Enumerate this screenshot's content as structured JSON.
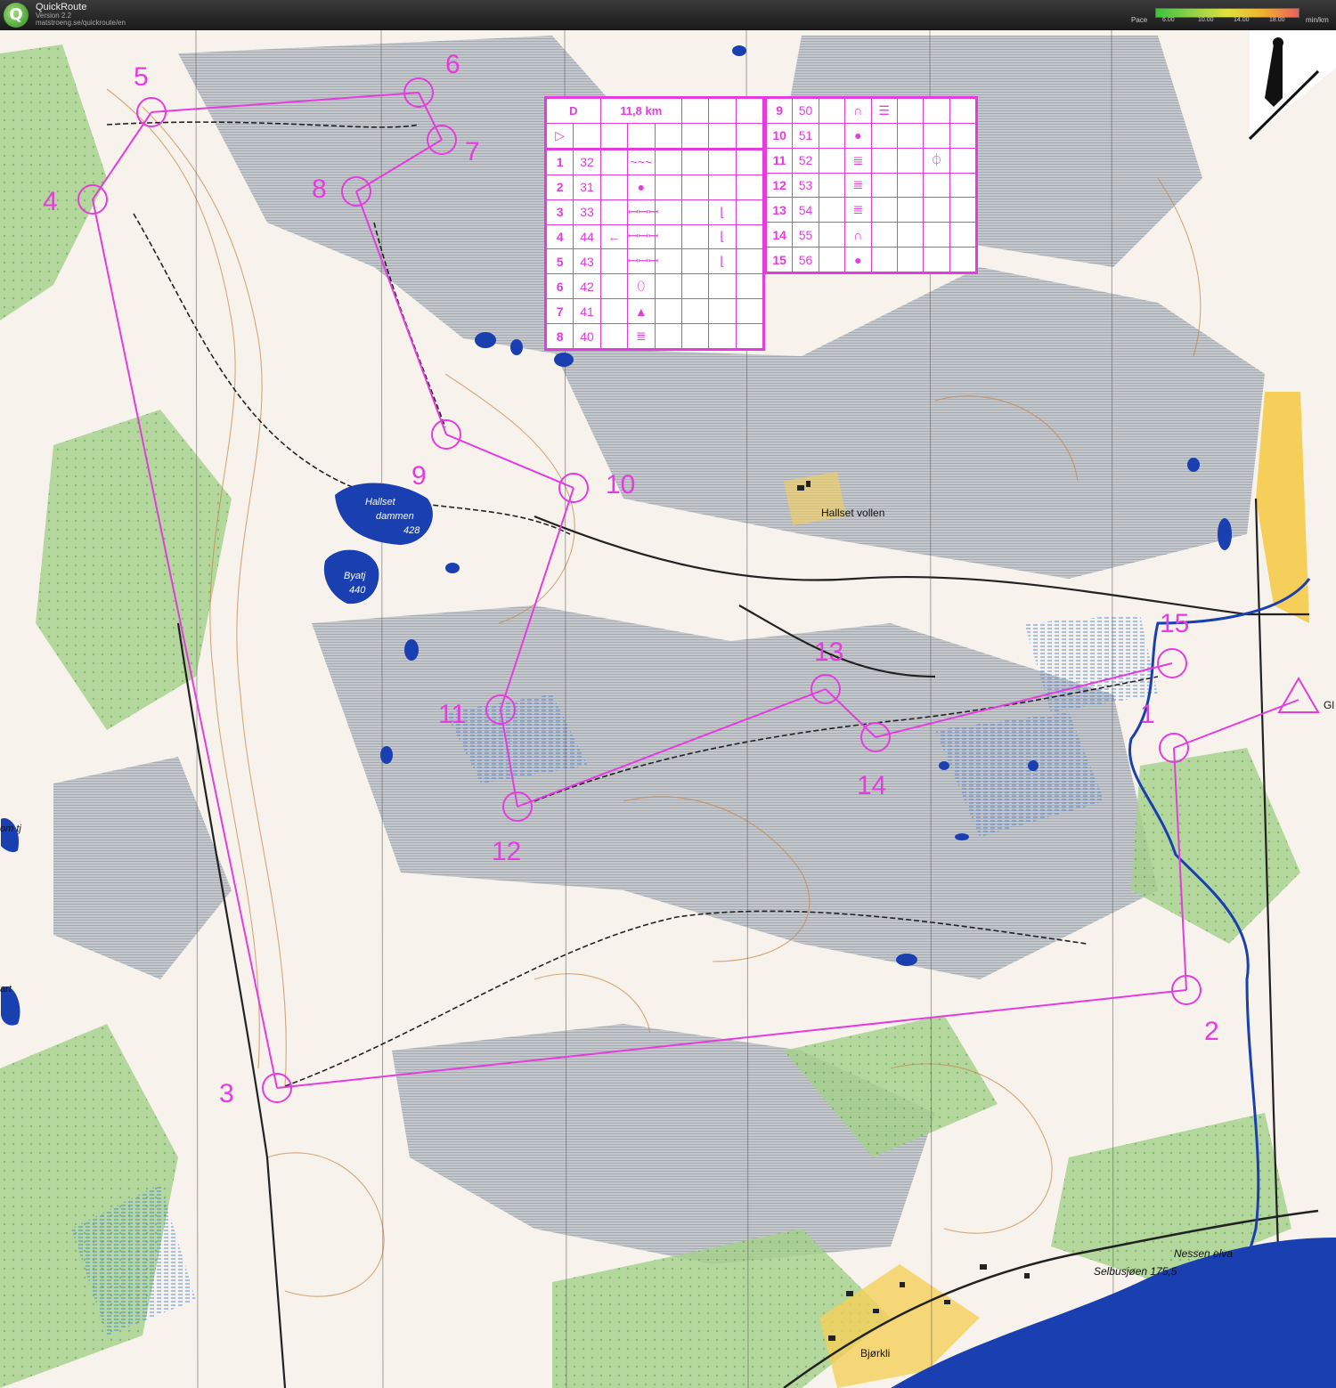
{
  "app": {
    "title": "QuickRoute",
    "version": "Version 2.2",
    "url": "matstroeng.se/quickroute/en",
    "pace_label": "Pace",
    "pace_ticks": [
      "6.00",
      "10.00",
      "14.00",
      "18.00"
    ],
    "pace_unit": "min/km"
  },
  "course": {
    "class": "D",
    "length": "11,8 km",
    "controls_left": [
      {
        "n": "1",
        "code": "32",
        "symbol": "~~~",
        "dir": "",
        "extra": ""
      },
      {
        "n": "2",
        "code": "31",
        "symbol": "●",
        "dir": "",
        "extra": ""
      },
      {
        "n": "3",
        "code": "33",
        "symbol": "ꟷꟷꟷ",
        "dir": "",
        "extra": "⌊"
      },
      {
        "n": "4",
        "code": "44",
        "symbol": "ꟷꟷꟷ",
        "dir": "←",
        "extra": "⌊"
      },
      {
        "n": "5",
        "code": "43",
        "symbol": "ꟷꟷꟷ",
        "dir": "",
        "extra": "⌊"
      },
      {
        "n": "6",
        "code": "42",
        "symbol": "⬯",
        "dir": "",
        "extra": ""
      },
      {
        "n": "7",
        "code": "41",
        "symbol": "▲",
        "dir": "",
        "extra": ""
      },
      {
        "n": "8",
        "code": "40",
        "symbol": "≣",
        "dir": "",
        "extra": ""
      }
    ],
    "controls_right": [
      {
        "n": "9",
        "code": "50",
        "symbol": "∩",
        "extra": "☰",
        "extra2": ""
      },
      {
        "n": "10",
        "code": "51",
        "symbol": "●",
        "extra": "",
        "extra2": ""
      },
      {
        "n": "11",
        "code": "52",
        "symbol": "≣",
        "extra": "",
        "extra2": "⏀"
      },
      {
        "n": "12",
        "code": "53",
        "symbol": "≣",
        "extra": "",
        "extra2": ""
      },
      {
        "n": "13",
        "code": "54",
        "symbol": "≣",
        "extra": "",
        "extra2": ""
      },
      {
        "n": "14",
        "code": "55",
        "symbol": "∩",
        "extra": "",
        "extra2": ""
      },
      {
        "n": "15",
        "code": "56",
        "symbol": "●",
        "extra": "",
        "extra2": ""
      }
    ],
    "start_symbol": "▷"
  },
  "map_labels": {
    "hallset_dammen": "Hallset",
    "hallset_dammen_2": "dammen",
    "hallset_dammen_h": "428",
    "byatj": "Byatj",
    "byatj_h": "440",
    "hallset_vollen": "Hallset vollen",
    "nessen": "Nessen elva",
    "selbusjoen": "Selbusjøen 175,5",
    "bjorkli": "Bjørkli",
    "gl": "Gl",
    "om_tj": "om tj",
    "art": "art"
  },
  "control_labels": [
    "1",
    "2",
    "3",
    "4",
    "5",
    "6",
    "7",
    "8",
    "9",
    "10",
    "11",
    "12",
    "13",
    "14",
    "15"
  ],
  "colors": {
    "course": "#e43cdf",
    "water": "#1a3fb0",
    "forest": "#ffffff",
    "open": "#f5d77a",
    "green": "#8cc07a",
    "rough": "#b9bcc0"
  }
}
